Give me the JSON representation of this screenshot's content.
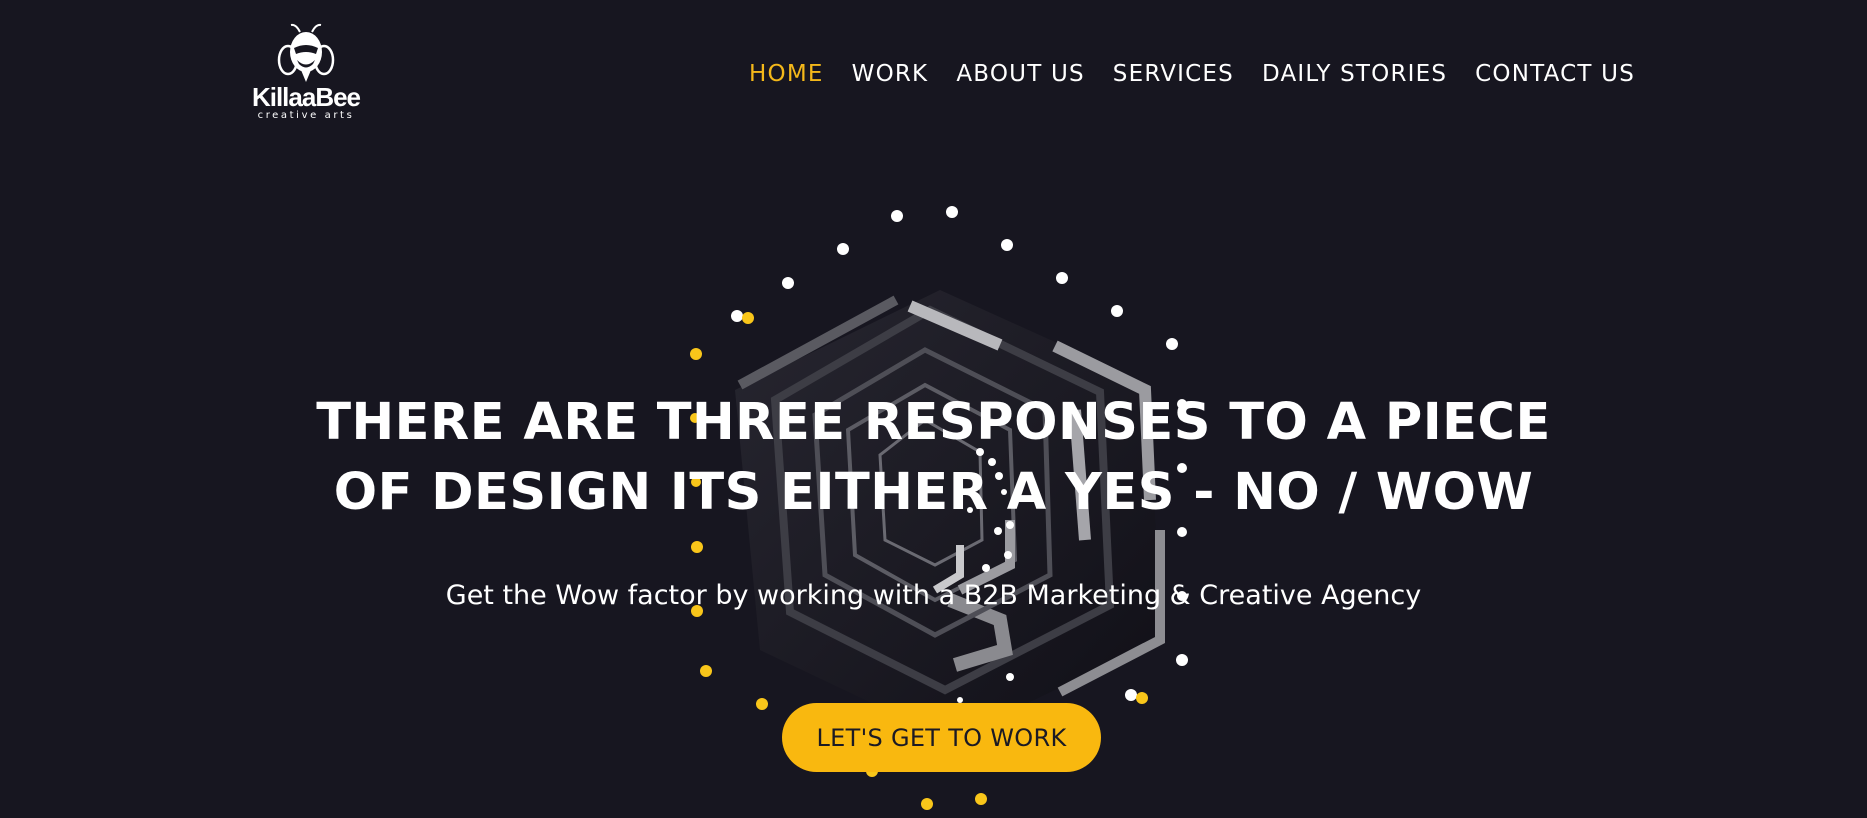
{
  "brand": {
    "name": "KillaaBee",
    "tagline": "creative arts",
    "accent_color": "#f9b80f",
    "background_color": "#171620",
    "logo_icon": "bee-icon"
  },
  "nav": {
    "items": [
      {
        "label": "HOME",
        "active": true
      },
      {
        "label": "WORK",
        "active": false
      },
      {
        "label": "ABOUT US",
        "active": false
      },
      {
        "label": "SERVICES",
        "active": false
      },
      {
        "label": "DAILY STORIES",
        "active": false
      },
      {
        "label": "CONTACT US",
        "active": false
      }
    ]
  },
  "hero": {
    "title_line1": "THERE ARE THREE RESPONSES TO A PIECE",
    "title_line2": "OF DESIGN ITS EITHER A YES - NO / WOW",
    "subtitle": "Get the Wow factor by working with a B2B Marketing & Creative Agency",
    "cta_label": "LET'S GET TO WORK"
  }
}
